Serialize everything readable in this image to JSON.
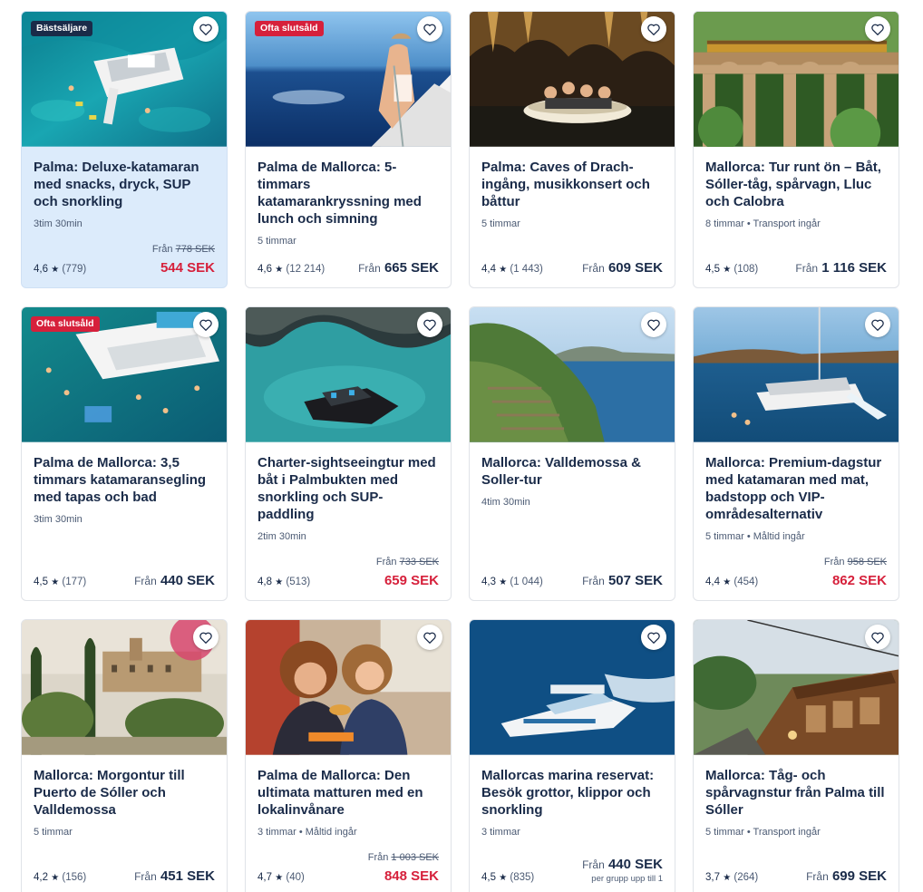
{
  "cards": [
    {
      "badge": "Bästsäljare",
      "badge_style": "dark",
      "title": "Palma: Deluxe-katamaran med snacks, dryck, SUP och snorkling",
      "meta": "3tim 30min",
      "rating": "4,6",
      "reviews": "(779)",
      "from_label": "Från",
      "original_price": "778 SEK",
      "price": "544 SEK",
      "sale": true,
      "highlight": true,
      "image": "catamaran-turquoise-sea"
    },
    {
      "badge": "Ofta slutsåld",
      "badge_style": "red",
      "title": "Palma de Mallorca: 5-timmars katamarankryssning med lunch och simning",
      "meta": "5 timmar",
      "rating": "4,6",
      "reviews": "(12 214)",
      "from_label": "Från",
      "price": "665 SEK",
      "sale": false,
      "image": "woman-on-boat-bow"
    },
    {
      "badge": "",
      "title": "Palma: Caves of Drach-ingång, musikkonsert och båttur",
      "meta": "5 timmar",
      "rating": "4,4",
      "reviews": "(1 443)",
      "from_label": "Från",
      "price": "609 SEK",
      "sale": false,
      "image": "cave-boat"
    },
    {
      "badge": "",
      "title": "Mallorca: Tur runt ön – Båt, Sóller-tåg, spårvagn, Lluc och Calobra",
      "meta": "8 timmar • Transport ingår",
      "rating": "4,5",
      "reviews": "(108)",
      "from_label": "Från",
      "price": "1 116 SEK",
      "sale": false,
      "image": "train-on-viaduct"
    },
    {
      "badge": "Ofta slutsåld",
      "badge_style": "red",
      "title": "Palma de Mallorca: 3,5 timmars katamaransegling med tapas och bad",
      "meta": "3tim 30min",
      "rating": "4,5",
      "reviews": "(177)",
      "from_label": "Från",
      "price": "440 SEK",
      "sale": false,
      "image": "catamaran-swimmers"
    },
    {
      "badge": "",
      "title": "Charter-sightseeingtur med båt i Palmbukten med snorkling och SUP-paddling",
      "meta": "2tim 30min",
      "rating": "4,8",
      "reviews": "(513)",
      "from_label": "Från",
      "original_price": "733 SEK",
      "price": "659 SEK",
      "sale": true,
      "image": "speedboat-cove"
    },
    {
      "badge": "",
      "title": "Mallorca: Valldemossa & Soller-tur",
      "meta": "4tim 30min",
      "rating": "4,3",
      "reviews": "(1 044)",
      "from_label": "Från",
      "price": "507 SEK",
      "sale": false,
      "image": "coastal-cliffs"
    },
    {
      "badge": "",
      "title": "Mallorca: Premium-dagstur med katamaran med mat, badstopp och VIP-områdesalternativ",
      "meta": "5 timmar • Måltid ingår",
      "rating": "4,4",
      "reviews": "(454)",
      "from_label": "Från",
      "original_price": "958 SEK",
      "price": "862 SEK",
      "sale": true,
      "image": "catamaran-slide"
    },
    {
      "badge": "",
      "title": "Mallorca: Morgontur till Puerto de Sóller och Valldemossa",
      "meta": "5 timmar",
      "rating": "4,2",
      "reviews": "(156)",
      "from_label": "Från",
      "price": "451 SEK",
      "sale": false,
      "image": "village-garden"
    },
    {
      "badge": "",
      "title": "Palma de Mallorca: Den ultimata matturen med en lokalinvånare",
      "meta": "3 timmar • Måltid ingår",
      "rating": "4,7",
      "reviews": "(40)",
      "from_label": "Från",
      "original_price": "1 003 SEK",
      "price": "848 SEK",
      "sale": true,
      "image": "women-eating"
    },
    {
      "badge": "",
      "title": "Mallorcas marina reservat: Besök grottor, klippor och snorkling",
      "meta": "3 timmar",
      "rating": "4,5",
      "reviews": "(835)",
      "from_label": "Från",
      "price": "440 SEK",
      "per": "per grupp upp till 1",
      "sale": false,
      "image": "speedboat-open-sea"
    },
    {
      "badge": "",
      "title": "Mallorca: Tåg- och spårvagnstur från Palma till Sóller",
      "meta": "5 timmar • Transport ingår",
      "rating": "3,7",
      "reviews": "(264)",
      "from_label": "Från",
      "price": "699 SEK",
      "sale": false,
      "image": "wooden-train"
    }
  ],
  "colors": {
    "accent_red": "#d6203b",
    "navy": "#1a2b49",
    "highlight_bg": "#dcebfb"
  }
}
